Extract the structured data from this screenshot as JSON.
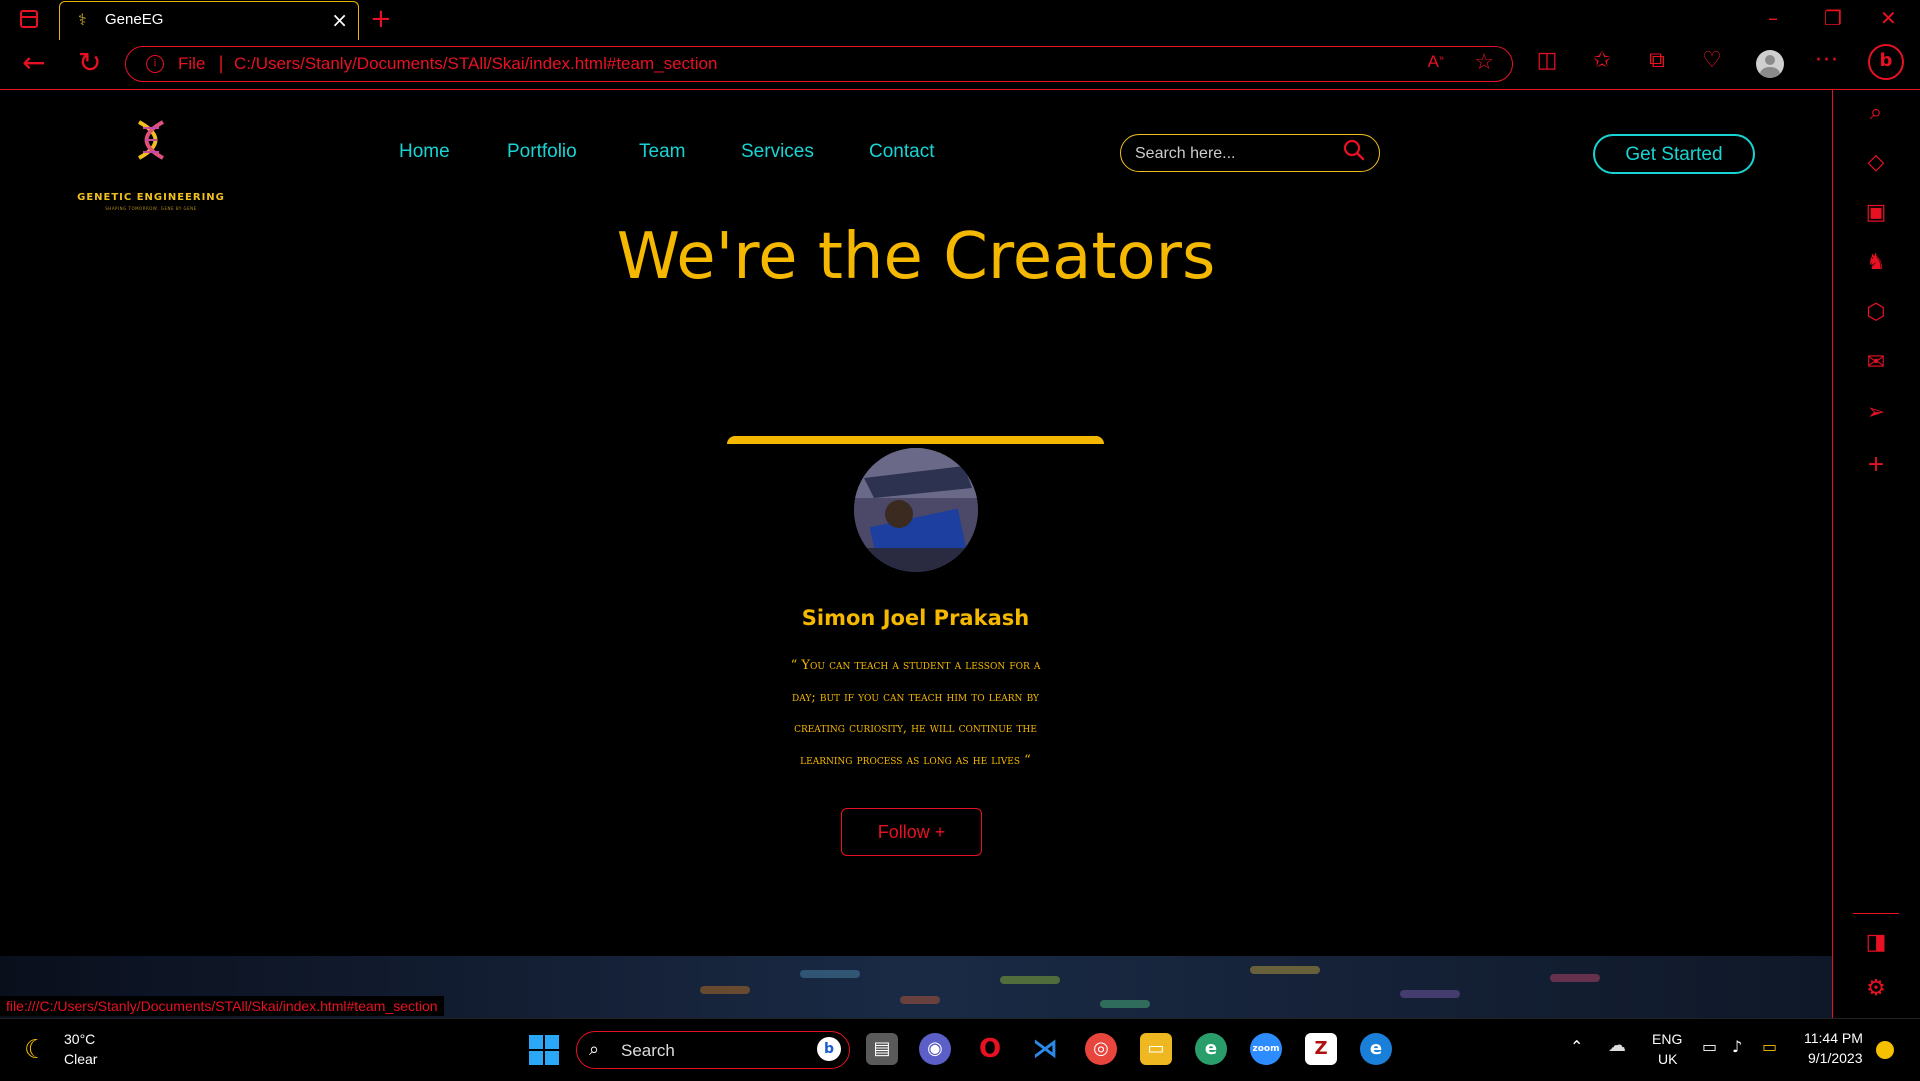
{
  "browser": {
    "tab_title": "GeneEG",
    "address_prefix": "File",
    "url": "C:/Users/Stanly/Documents/STAll/Skai/index.html#team_section",
    "status_url": "file:///C:/Users/Stanly/Documents/STAll/Skai/index.html#team_section",
    "accent_color": "#e81123"
  },
  "site": {
    "logo_text": "GENETIC ENGINEERING",
    "logo_tagline": "SHAPING TOMORROW, GENE BY GENE",
    "nav": [
      "Home",
      "Portfolio",
      "Team",
      "Services",
      "Contact"
    ],
    "search_placeholder": "Search here...",
    "cta_label": "Get Started",
    "nav_color": "#19d4d4",
    "heading_color": "#f5b800"
  },
  "team_section": {
    "title": "We're the Creators",
    "member": {
      "name": "Simon Joel Prakash",
      "quote_lines": [
        "“ You can teach a student a lesson for a",
        "day; but if you can teach him to learn by",
        "creating curiosity, he will continue the",
        "learning process as long as he lives “"
      ],
      "follow_label": "Follow +"
    }
  },
  "taskbar": {
    "weather_temp": "30°C",
    "weather_desc": "Clear",
    "search_label": "Search",
    "lang_line1": "ENG",
    "lang_line2": "UK",
    "time": "11:44 PM",
    "date": "9/1/2023",
    "apps": [
      "task-view",
      "teams",
      "opera",
      "vscode",
      "chrome",
      "file-explorer",
      "edge-beta",
      "zoom",
      "filezilla",
      "edge"
    ]
  }
}
